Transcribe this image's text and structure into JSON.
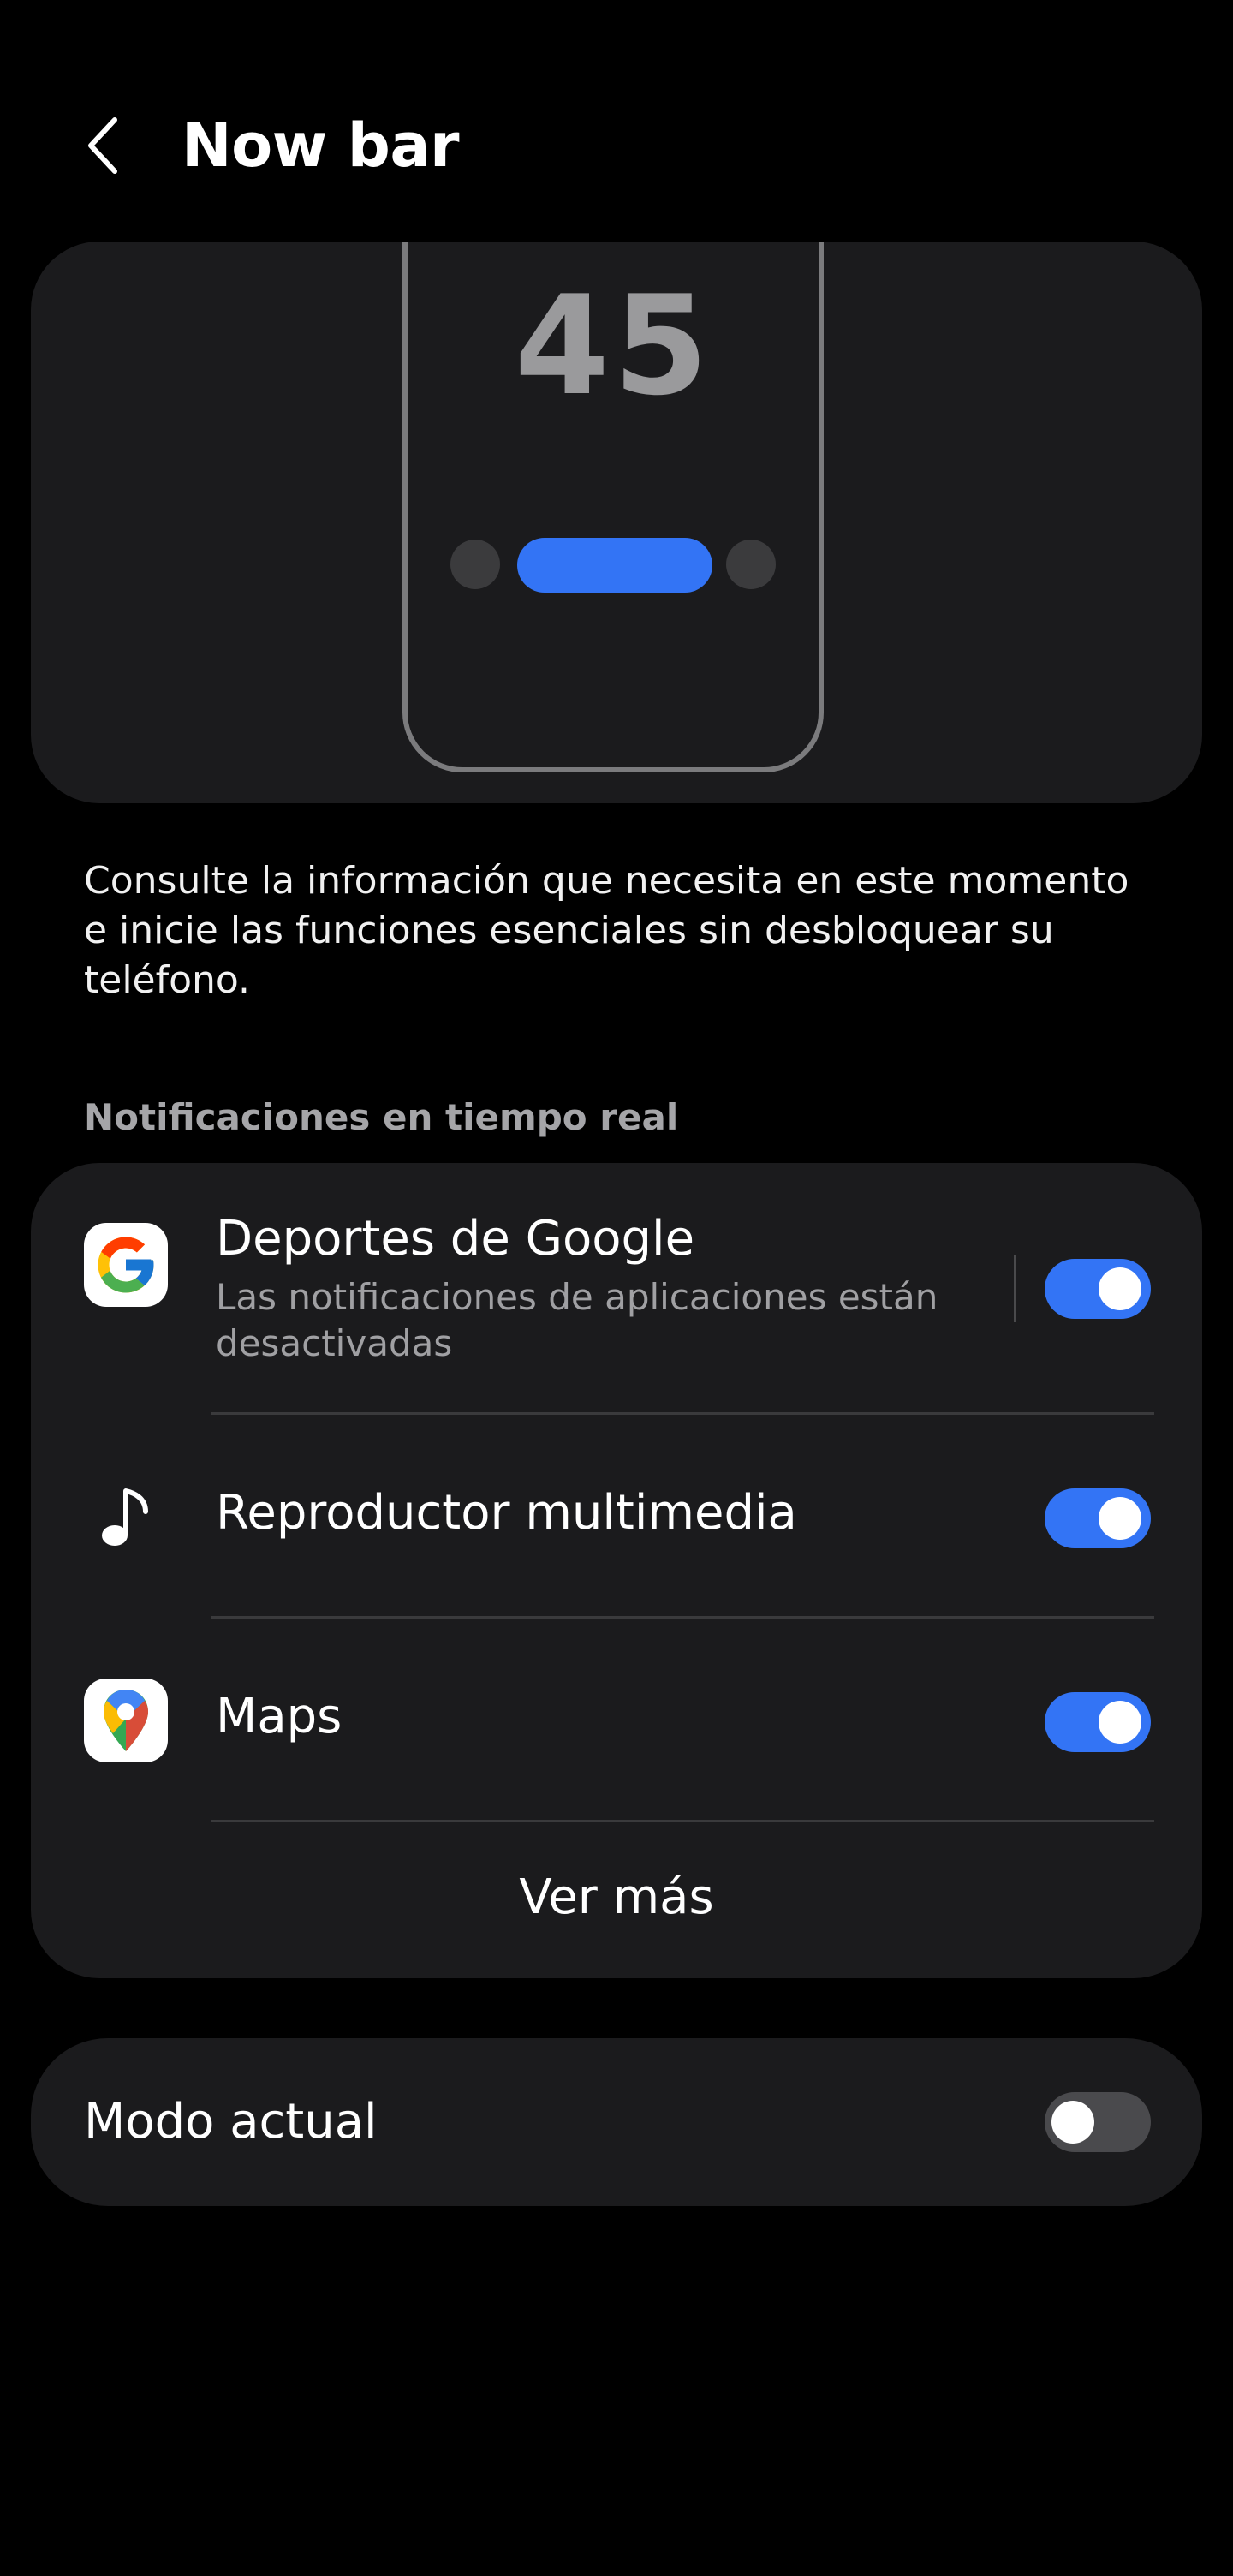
{
  "header": {
    "title": "Now bar",
    "back_icon": "chevron-left-icon"
  },
  "preview": {
    "clock_digits": "45",
    "accent_color": "#3374f5"
  },
  "description": "Consulte la información que necesita en este momento e inicie las funciones esenciales sin desbloquear su teléfono.",
  "live_notifications": {
    "section_title": "Notificaciones en tiempo real",
    "items": [
      {
        "title": "Deportes de Google",
        "subtitle": "Las notificaciones de aplicaciones están desactivadas",
        "icon": "google-g-icon",
        "enabled": true
      },
      {
        "title": "Reproductor multimedia",
        "icon": "music-note-icon",
        "enabled": true
      },
      {
        "title": "Maps",
        "icon": "google-maps-icon",
        "enabled": true
      }
    ],
    "more_label": "Ver más"
  },
  "current_mode": {
    "label": "Modo actual",
    "enabled": false
  },
  "colors": {
    "background": "#000000",
    "card": "#1b1b1d",
    "toggle_on": "#3374f5",
    "toggle_off": "#4a4a4d"
  }
}
